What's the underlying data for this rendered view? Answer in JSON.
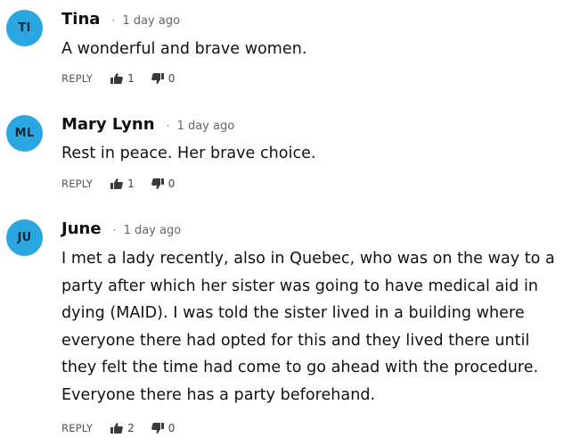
{
  "comments": [
    {
      "initials": "TI",
      "author": "Tina",
      "separator": "·",
      "time": "1 day ago",
      "text": "A wonderful and brave women.",
      "reply_label": "REPLY",
      "likes": "1",
      "dislikes": "0"
    },
    {
      "initials": "ML",
      "author": "Mary Lynn",
      "separator": "·",
      "time": "1 day ago",
      "text": "Rest in peace. Her brave choice.",
      "reply_label": "REPLY",
      "likes": "1",
      "dislikes": "0"
    },
    {
      "initials": "JU",
      "author": "June",
      "separator": "·",
      "time": "1 day ago",
      "text": "I met a lady recently, also in Quebec, who was on the way to a party after which her sister was going to have medical aid in dying (MAID). I was told the sister lived in a building where everyone there had opted for this and they lived there until they felt the time had come to go ahead with the procedure. Everyone there has a party beforehand.",
      "reply_label": "REPLY",
      "likes": "2",
      "dislikes": "0"
    }
  ],
  "colors": {
    "avatar_bg": "#2aa6e0",
    "avatar_text": "#102a3a",
    "meta_text": "#666666",
    "body_text": "#111111"
  },
  "icons": {
    "like": "thumbs-up-icon",
    "dislike": "thumbs-down-icon"
  }
}
